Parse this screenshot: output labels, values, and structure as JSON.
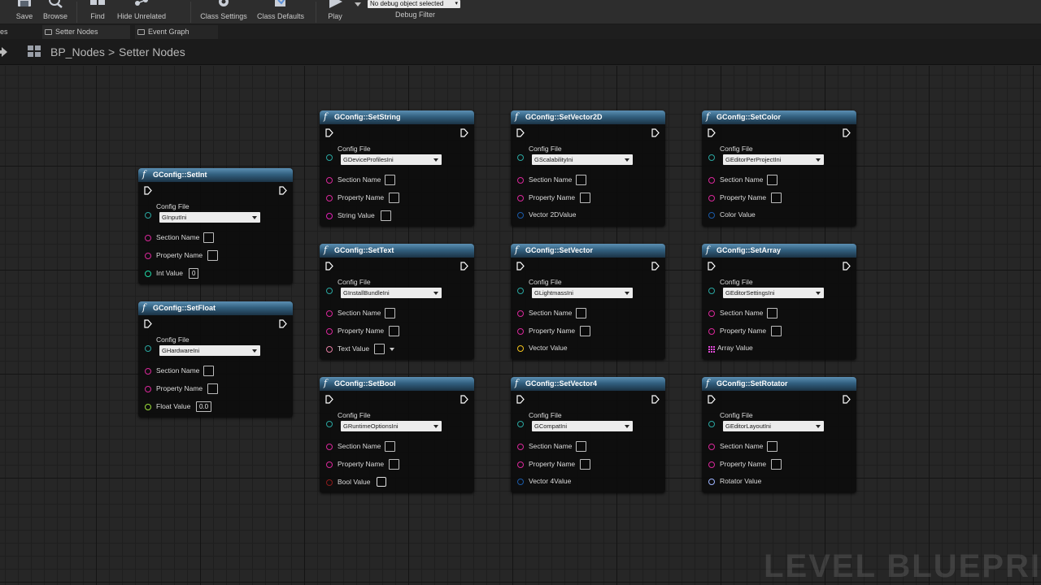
{
  "toolbar": {
    "buttons": [
      {
        "label": "Save",
        "icon": "save-icon"
      },
      {
        "label": "Browse",
        "icon": "browse-icon"
      },
      {
        "label": "Find",
        "icon": "find-icon"
      },
      {
        "label": "Hide Unrelated",
        "icon": "hide-unrelated-icon"
      },
      {
        "label": "Class Settings",
        "icon": "class-settings-icon"
      },
      {
        "label": "Class Defaults",
        "icon": "class-defaults-icon"
      },
      {
        "label": "Play",
        "icon": "play-icon"
      }
    ],
    "debug_select": "No debug object selected",
    "debug_label": "Debug Filter"
  },
  "tabs": {
    "left_partial": "es",
    "items": [
      {
        "label": "Setter Nodes",
        "icon": "graph-tab-icon"
      },
      {
        "label": "Event Graph",
        "icon": "graph-tab-icon"
      }
    ]
  },
  "breadcrumb": {
    "blueprint": "BP_Nodes",
    "separator": ">",
    "graph": "Setter Nodes"
  },
  "pin_labels": {
    "config_file": "Config File",
    "section_name": "Section Name",
    "property_name": "Property Name"
  },
  "nodes": {
    "set_int": {
      "title": "GConfig::SetInt",
      "config": "GInputIni",
      "value_label": "Int Value",
      "value": "0"
    },
    "set_float": {
      "title": "GConfig::SetFloat",
      "config": "GHardwareIni",
      "value_label": "Float Value",
      "value": "0.0"
    },
    "set_string": {
      "title": "GConfig::SetString",
      "config": "GDeviceProfilesIni",
      "value_label": "String Value"
    },
    "set_text": {
      "title": "GConfig::SetText",
      "config": "GInstallBundleIni",
      "value_label": "Text Value"
    },
    "set_bool": {
      "title": "GConfig::SetBool",
      "config": "GRuntimeOptionsIni",
      "value_label": "Bool Value"
    },
    "set_vector2d": {
      "title": "GConfig::SetVector2D",
      "config": "GScalabilityIni",
      "value_label": "Vector 2DValue"
    },
    "set_vector": {
      "title": "GConfig::SetVector",
      "config": "GLightmassIni",
      "value_label": "Vector Value"
    },
    "set_vector4": {
      "title": "GConfig::SetVector4",
      "config": "GCompatIni",
      "value_label": "Vector 4Value"
    },
    "set_color": {
      "title": "GConfig::SetColor",
      "config": "GEditorPerProjectIni",
      "value_label": "Color Value"
    },
    "set_array": {
      "title": "GConfig::SetArray",
      "config": "GEditorSettingsIni",
      "value_label": "Array Value"
    },
    "set_rotator": {
      "title": "GConfig::SetRotator",
      "config": "GEditorLayoutIni",
      "value_label": "Rotator Value"
    }
  },
  "pin_colors": {
    "exec": "#ffffff",
    "config": "#2aa6a0",
    "name": "#d9279a",
    "string": "#e01fb5",
    "text": "#e27ca0",
    "int": "#1fd8a6",
    "float": "#9bdf3a",
    "bool": "#8c1b1b",
    "vector2d": "#1a5aa8",
    "vector": "#f2c21c",
    "vector4": "#1a5aa8",
    "color": "#1a5aa8",
    "array": "#e24bd9",
    "rotator": "#9db4ff"
  },
  "watermark": "LEVEL BLUEPRI"
}
